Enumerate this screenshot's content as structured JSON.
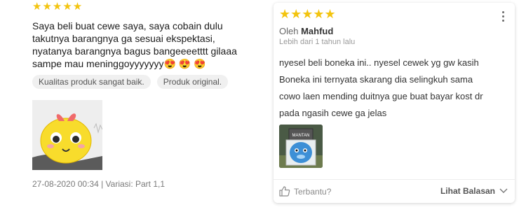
{
  "left_review": {
    "rating": 5,
    "text_lines": [
      "Saya beli buat cewe saya, saya cobain dulu",
      "takutnya barangnya ga sesuai ekspektasi,",
      "nyatanya barangnya bagus bangeeeetttt gilaaa",
      "sampe mau meninggoyyyyyyy😍 😍 😍"
    ],
    "tags": [
      "Kualitas produk sangat baik.",
      "Produk original."
    ],
    "meta": "27-08-2020 00:34 | Variasi: Part 1,1"
  },
  "right_review": {
    "rating": 5,
    "author_prefix": "Oleh",
    "author_name": "Mahfud",
    "time": "Lebih dari 1 tahun lalu",
    "text_lines": [
      "nyesel beli boneka ini.. nyesel cewek yg gw kasih",
      "Boneka ini ternyata skarang dia selingkuh sama",
      "cowo laen mending duitnya gue buat bayar kost dr",
      "pada ngasih cewe ga jelas"
    ],
    "photo_label": "MANTAN",
    "helpful_label": "Terbantu?",
    "replies_label": "Lihat Balasan"
  },
  "colors": {
    "star": "#f3c40f"
  },
  "icons": {
    "helpful": "thumbs-up-icon",
    "menu": "kebab-menu-icon",
    "expand": "chevron-down-icon"
  }
}
